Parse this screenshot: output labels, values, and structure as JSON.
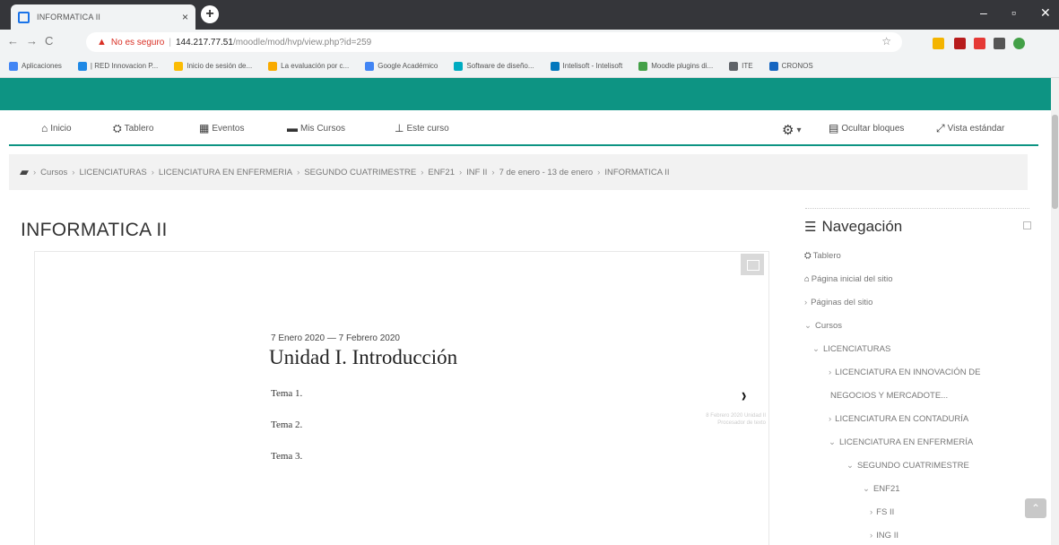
{
  "browser": {
    "tab_title": "INFORMATICA II",
    "tab_close": "×",
    "new_tab": "+",
    "window_controls": {
      "minimize": "–",
      "maximize": "▫",
      "close": "✕"
    },
    "nav_icons": {
      "back": "←",
      "forward": "→",
      "reload": "C"
    },
    "security_label": "No es seguro",
    "url_host": "144.217.77.51",
    "url_path": "/moodle/mod/hvp/view.php?id=259",
    "star_icon": "☆",
    "bookmarks": [
      "Aplicaciones",
      "| RED Innovacion P...",
      "Inicio de sesión de...",
      "La evaluación por c...",
      "Google Académico",
      "Software de diseño...",
      "Intelisoft - Intelisoft",
      "Moodle plugins di...",
      "ITE",
      "CRONOS"
    ],
    "extension_colors": [
      "#f4b400",
      "#b71c1c",
      "#e53935",
      "#555555",
      "#43a047"
    ]
  },
  "moodle": {
    "accent_color": "#0d9483",
    "nav": {
      "inicio": "Inicio",
      "tablero": "Tablero",
      "eventos": "Eventos",
      "mis_cursos": "Mis Cursos",
      "este_curso": "Este curso",
      "settings_caret": "▾",
      "ocultar_bloques": "Ocultar bloques",
      "vista_estandar": "Vista estándar"
    },
    "breadcrumb": [
      "Cursos",
      "LICENCIATURAS",
      "LICENCIATURA EN ENFERMERIA",
      "SEGUNDO CUATRIMESTRE",
      "ENF21",
      "INF II",
      "7 de enero - 13 de enero",
      "INFORMATICA II"
    ],
    "breadcrumb_sep": "›",
    "page_title": "INFORMATICA II",
    "slide": {
      "date": "7 Enero 2020 — 7 Febrero 2020",
      "title": "Unidad I. Introducción",
      "topics": [
        "Tema 1.",
        "Tema 2.",
        "Tema 3."
      ],
      "next_arrow": "›",
      "next_preview": "8 Febrero 2020 Unidad II Procesador de texto"
    },
    "navigation": {
      "heading": "Navegación",
      "items": [
        {
          "label": "Tablero",
          "icon": "dashboard-icon",
          "glyph": "⛭",
          "expander": ""
        },
        {
          "label": "Página inicial del sitio",
          "icon": "home-icon",
          "glyph": "⌂",
          "expander": ""
        },
        {
          "label": "Páginas del sitio",
          "icon": "",
          "glyph": "",
          "expander": "›"
        },
        {
          "label": "Cursos",
          "icon": "",
          "glyph": "",
          "expander": "⌄"
        },
        {
          "label": "LICENCIATURAS",
          "icon": "",
          "glyph": "",
          "expander": "⌄"
        },
        {
          "label": "LICENCIATURA EN INNOVACIÓN DE",
          "icon": "",
          "glyph": "",
          "expander": "›"
        },
        {
          "label": "NEGOCIOS Y MERCADOTE...",
          "icon": "",
          "glyph": "",
          "expander": ""
        },
        {
          "label": "LICENCIATURA EN CONTADURÍA",
          "icon": "",
          "glyph": "",
          "expander": "›"
        },
        {
          "label": "LICENCIATURA EN ENFERMERÍA",
          "icon": "",
          "glyph": "",
          "expander": "⌄"
        },
        {
          "label": "SEGUNDO CUATRIMESTRE",
          "icon": "",
          "glyph": "",
          "expander": "⌄"
        },
        {
          "label": "ENF21",
          "icon": "",
          "glyph": "",
          "expander": "⌄"
        },
        {
          "label": "FS II",
          "icon": "",
          "glyph": "",
          "expander": "›"
        },
        {
          "label": "ING II",
          "icon": "",
          "glyph": "",
          "expander": "›"
        }
      ]
    },
    "scroll_top": "⌃"
  }
}
